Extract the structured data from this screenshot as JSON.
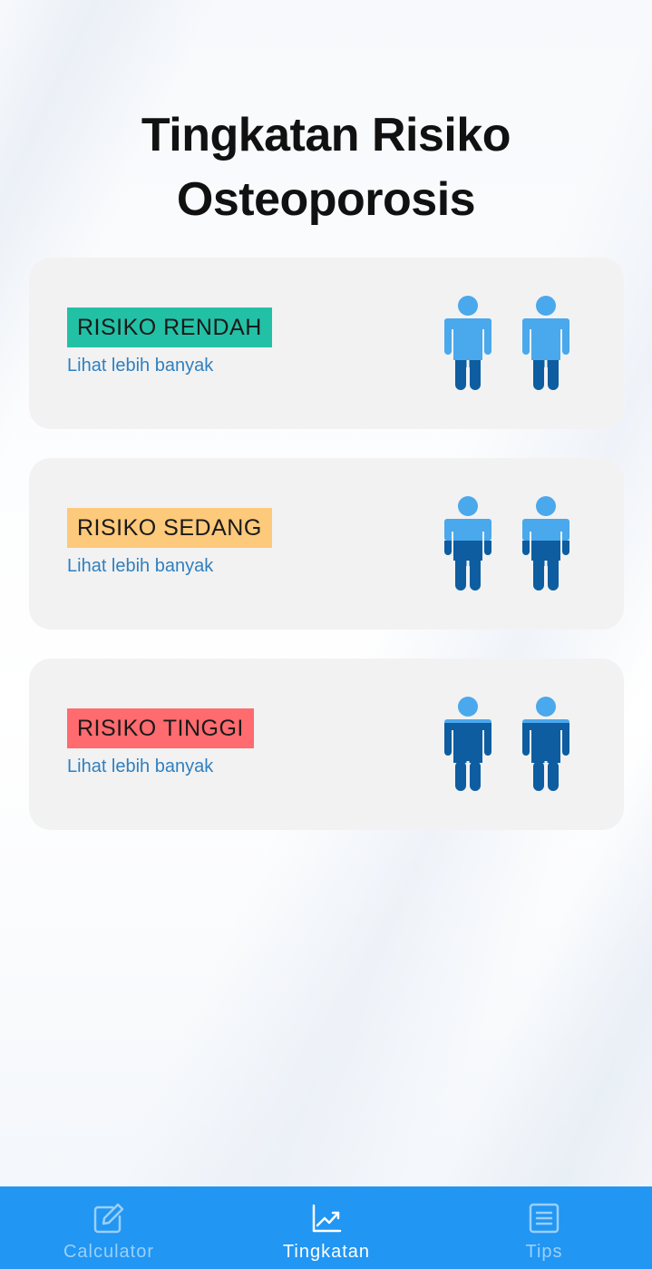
{
  "page": {
    "title_line1": "Tingkatan Risiko",
    "title_line2": "Osteoporosis"
  },
  "cards": [
    {
      "badge": "RISIKO RENDAH",
      "badge_color": "#22c1a6",
      "link": "Lihat lebih banyak",
      "fill_level": "low"
    },
    {
      "badge": "RISIKO SEDANG",
      "badge_color": "#fdc97a",
      "link": "Lihat lebih banyak",
      "fill_level": "medium"
    },
    {
      "badge": "RISIKO TINGGI",
      "badge_color": "#ff6b6e",
      "link": "Lihat lebih banyak",
      "fill_level": "high"
    }
  ],
  "colors": {
    "figure_light": "#4aa8ec",
    "figure_dark": "#0d5da0",
    "tabbar": "#2196f3",
    "link": "#2f7fc0"
  },
  "tabbar": {
    "tabs": [
      {
        "label": "Calculator",
        "icon": "edit-icon",
        "active": false
      },
      {
        "label": "Tingkatan",
        "icon": "trending-up-icon",
        "active": true
      },
      {
        "label": "Tips",
        "icon": "list-icon",
        "active": false
      }
    ]
  }
}
